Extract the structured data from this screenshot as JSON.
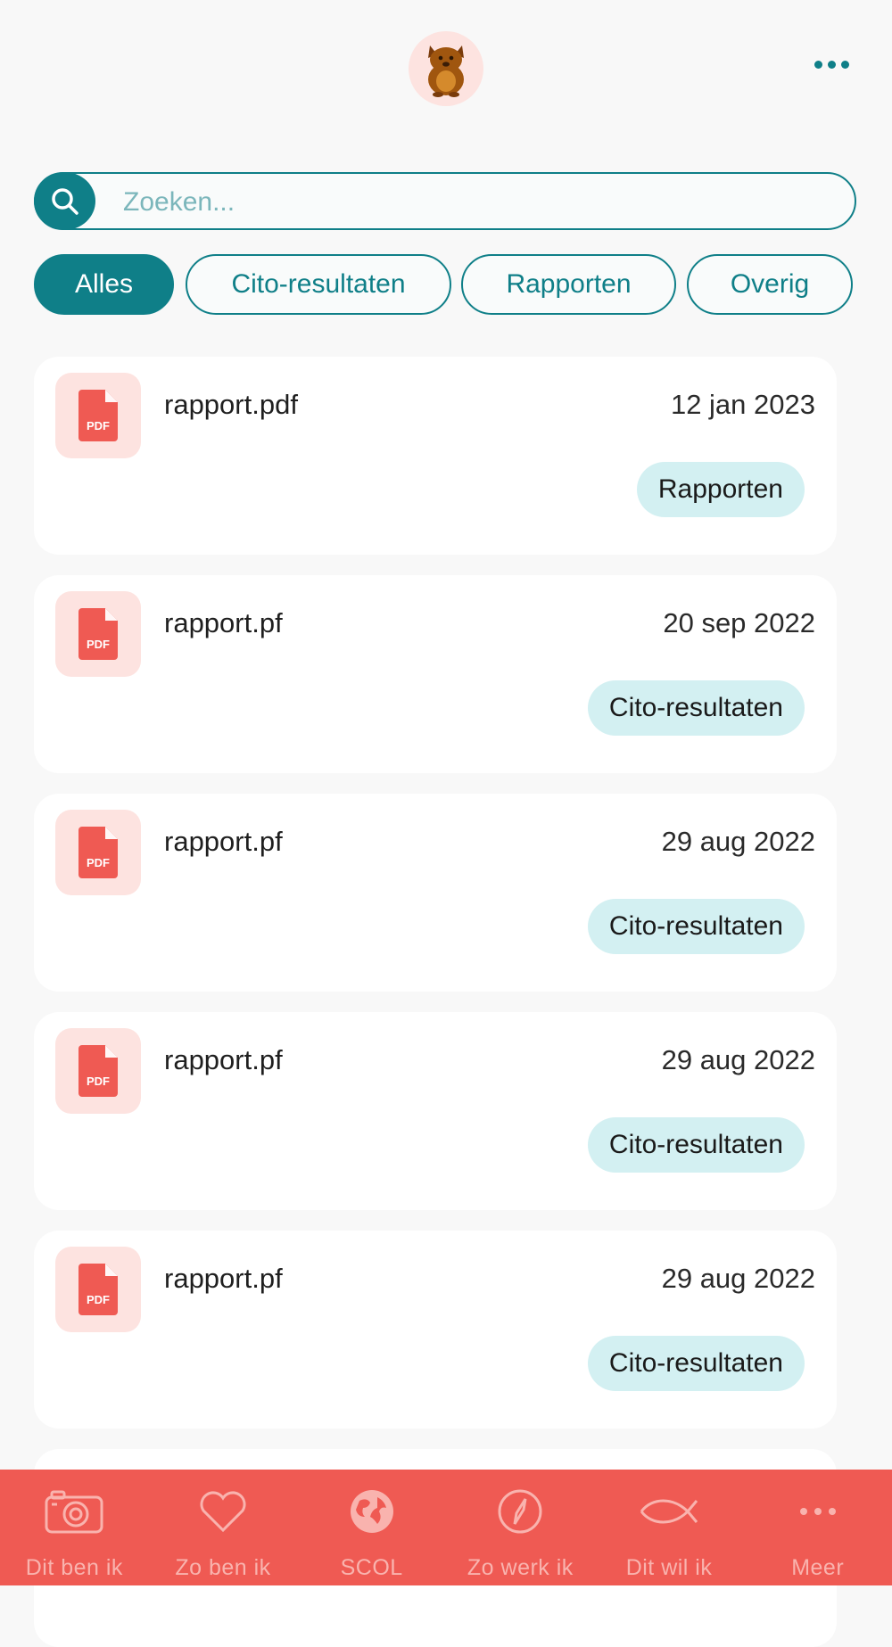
{
  "header": {
    "avatar_icon": "bear-mascot-icon",
    "more_icon": "more-horizontal-icon"
  },
  "search": {
    "placeholder": "Zoeken...",
    "value": "",
    "icon": "search-icon"
  },
  "filters": [
    {
      "label": "Alles",
      "active": true
    },
    {
      "label": "Cito-resultaten",
      "active": false
    },
    {
      "label": "Rapporten",
      "active": false
    },
    {
      "label": "Overig",
      "active": false
    }
  ],
  "documents": [
    {
      "name": "rapport.pdf",
      "date": "12 jan 2023",
      "tag": "Rapporten",
      "icon": "pdf-file-icon"
    },
    {
      "name": "rapport.pf",
      "date": "20 sep 2022",
      "tag": "Cito-resultaten",
      "icon": "pdf-file-icon"
    },
    {
      "name": "rapport.pf",
      "date": "29 aug 2022",
      "tag": "Cito-resultaten",
      "icon": "pdf-file-icon"
    },
    {
      "name": "rapport.pf",
      "date": "29 aug 2022",
      "tag": "Cito-resultaten",
      "icon": "pdf-file-icon"
    },
    {
      "name": "rapport.pf",
      "date": "29 aug 2022",
      "tag": "Cito-resultaten",
      "icon": "pdf-file-icon"
    }
  ],
  "pdf_badge_text": "PDF",
  "bottom_nav": [
    {
      "label": "Dit ben ik",
      "icon": "camera-icon"
    },
    {
      "label": "Zo ben ik",
      "icon": "heart-icon"
    },
    {
      "label": "SCOL",
      "icon": "globe-icon"
    },
    {
      "label": "Zo werk ik",
      "icon": "compass-icon"
    },
    {
      "label": "Dit wil ik",
      "icon": "fish-icon"
    },
    {
      "label": "Meer",
      "icon": "more-horizontal-icon"
    }
  ],
  "colors": {
    "primary": "#0f7f88",
    "accent_nav": "#ef5a53",
    "tag_bg": "#d3f0f2",
    "pdf_red": "#ef5a53",
    "pdf_tile_bg": "#fde3e0",
    "background": "#f8f8f8"
  }
}
